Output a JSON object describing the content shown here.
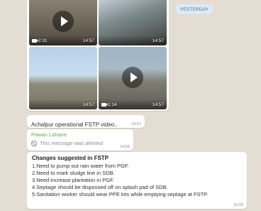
{
  "date_separator": "YESTERDAY",
  "media": {
    "tiles": [
      {
        "duration": "2:31",
        "time": "14:57"
      },
      {
        "duration": "",
        "time": "14:57"
      },
      {
        "duration": "",
        "time": "14:57"
      },
      {
        "duration": "1:14",
        "time": "14:57"
      }
    ]
  },
  "caption": {
    "text": "Achalpur operational FSTP video..",
    "time": "14:57"
  },
  "deleted": {
    "sender": "Pawan Lahane",
    "text": "This message was deleted",
    "time": "14:58"
  },
  "changes": {
    "title": "Changes suggested in FSTP",
    "lines": [
      "1.Need to pump out rain water from PGF.",
      "2.Need to mark sludge line in SDB.",
      "3.Need increase plantation in PGF.",
      "4.Septage should be dispossed off on splash pad of SDB.",
      "5.Sanitation worker should wear PPE kits while emptying septage at FSTP."
    ],
    "time": "15:05"
  },
  "colors": {
    "chat_background": "#e4ddd4",
    "sender_name": "#6aa84f",
    "date_pill": "#dcebf7"
  }
}
